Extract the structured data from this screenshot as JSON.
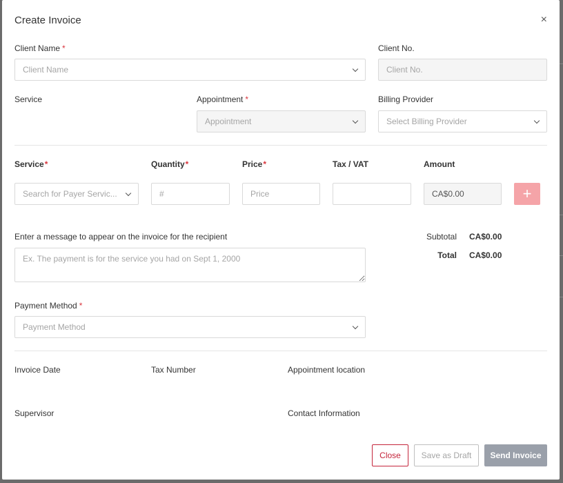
{
  "modal": {
    "title": "Create Invoice",
    "close_symbol": "×"
  },
  "client": {
    "name_label": "Client Name",
    "name_placeholder": "Client Name",
    "number_label": "Client No.",
    "number_placeholder": "Client No."
  },
  "service_section": {
    "service_label": "Service",
    "appointment_label": "Appointment",
    "appointment_placeholder": "Appointment",
    "billing_label": "Billing Provider",
    "billing_placeholder": "Select Billing Provider"
  },
  "line_item": {
    "headers": {
      "service": "Service",
      "quantity": "Quantity",
      "price": "Price",
      "tax": "Tax / VAT",
      "amount": "Amount"
    },
    "service_placeholder": "Search for Payer Servic...",
    "quantity_placeholder": "#",
    "price_placeholder": "Price",
    "tax_value": "",
    "amount_value": "CA$0.00",
    "add_symbol": "+"
  },
  "message": {
    "label": "Enter a message to appear on the invoice for the recipient",
    "placeholder": "Ex. The payment is for the service you had on Sept 1, 2000"
  },
  "totals": {
    "subtotal_label": "Subtotal",
    "subtotal_value": "CA$0.00",
    "total_label": "Total",
    "total_value": "CA$0.00"
  },
  "payment": {
    "label": "Payment Method",
    "placeholder": "Payment Method"
  },
  "details": {
    "invoice_date_label": "Invoice Date",
    "tax_number_label": "Tax Number",
    "appointment_location_label": "Appointment location",
    "supervisor_label": "Supervisor",
    "contact_information_label": "Contact Information"
  },
  "footer": {
    "close_label": "Close",
    "draft_label": "Save as Draft",
    "send_label": "Send Invoice"
  },
  "required_mark": "*",
  "colors": {
    "required": "#d9363e",
    "close_button": "#c4243a",
    "add_button": "#f5a4a8",
    "send_button": "#9aa0aa"
  }
}
